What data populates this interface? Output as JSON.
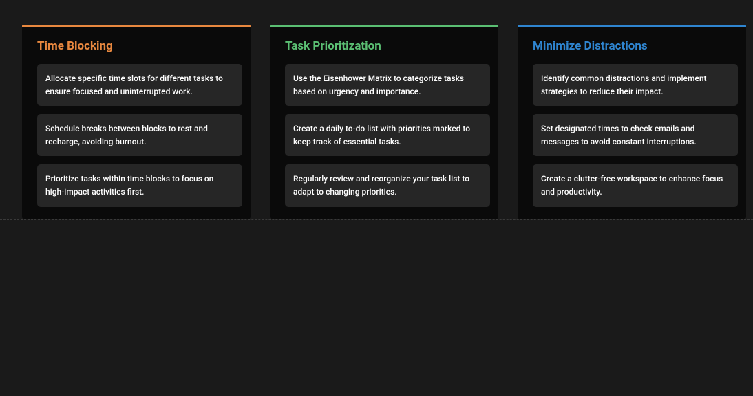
{
  "cards": [
    {
      "title": "Time Blocking",
      "color": "orange",
      "tips": [
        "Allocate specific time slots for different tasks to ensure focused and uninterrupted work.",
        "Schedule breaks between blocks to rest and recharge, avoiding burnout.",
        "Prioritize tasks within time blocks to focus on high-impact activities first."
      ]
    },
    {
      "title": "Task Prioritization",
      "color": "green",
      "tips": [
        "Use the Eisenhower Matrix to categorize tasks based on urgency and importance.",
        "Create a daily to-do list with priorities marked to keep track of essential tasks.",
        "Regularly review and reorganize your task list to adapt to changing priorities."
      ]
    },
    {
      "title": "Minimize Distractions",
      "color": "blue",
      "tips": [
        "Identify common distractions and implement strategies to reduce their impact.",
        "Set designated times to check emails and messages to avoid constant interruptions.",
        "Create a clutter-free workspace to enhance focus and productivity."
      ]
    }
  ]
}
